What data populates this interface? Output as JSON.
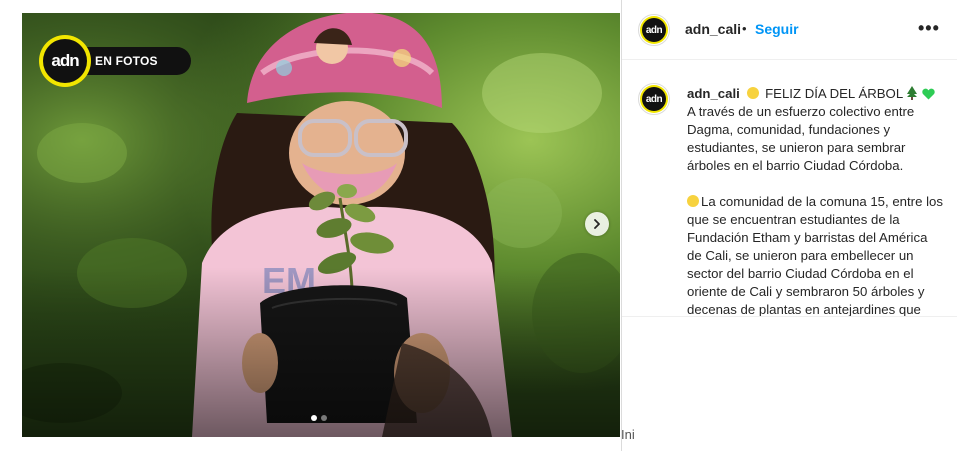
{
  "post": {
    "username": "adn_cali",
    "separator": "•",
    "follow_label": "Seguir",
    "more_label": "•••",
    "avatar_text": "adn"
  },
  "photo": {
    "logo_text": "adn",
    "badge_text": "EN FOTOS",
    "carousel": {
      "total": 2,
      "current": 1
    },
    "stray_text": "Ini"
  },
  "caption": {
    "username": "adn_cali",
    "headline": "FELIZ DÍA DEL ÁRBOL",
    "paragraph1": "A través de un esfuerzo colectivo entre Dagma, comunidad, fundaciones y estudiantes, se unieron para sembrar árboles en el barrio Ciudad Córdoba.",
    "paragraph2": "La comunidad de la comuna 15, entre los que se encuentran estudiantes de la Fundación Etham y barristas del América de Cali, se unieron para embellecer un sector del barrio Ciudad Córdoba en el oriente de Cali y sembraron 50 árboles y decenas de plantas en antejardines que"
  },
  "colors": {
    "brand_yellow": "#f2e600",
    "follow_blue": "#0095f6",
    "heart_green": "#2ecc55",
    "text": "#262626"
  },
  "icons": [
    "next-arrow-icon",
    "more-options-icon",
    "yellow-circle-emoji",
    "tree-emoji",
    "green-heart-emoji"
  ]
}
